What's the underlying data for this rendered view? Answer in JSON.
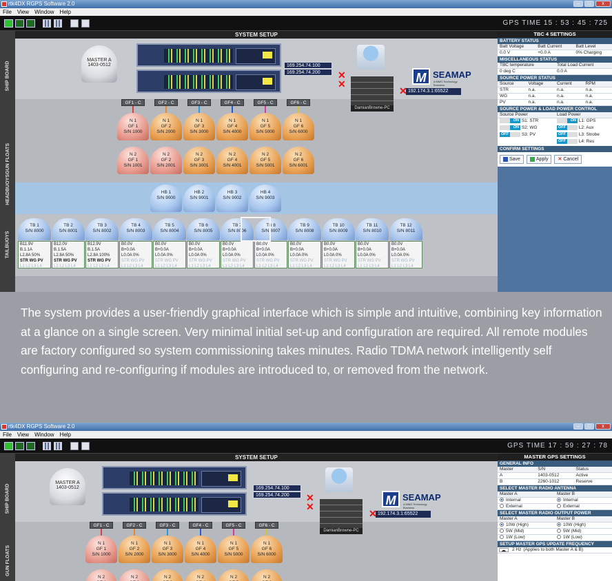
{
  "window": {
    "title": "rtk4DX RGPS Software 2.0",
    "menu": [
      "File",
      "View",
      "Window",
      "Help"
    ]
  },
  "screen1": {
    "gps_time": "GPS TIME  15 : 53 : 45 : 725",
    "system_setup": "SYSTEM SETUP",
    "sidebar": [
      "SHIP BOARD",
      "GUN FLOATS",
      "HEADBUOYS",
      "TAILBUOYS"
    ],
    "master": {
      "name": "MASTER A",
      "serial": "1403-0512"
    },
    "rack_rows": [
      "warn · pwr · lock · sv",
      "tx · rx · rxf · err"
    ],
    "rack_eth": [
      "ethnet link 100b tx rx",
      "ethnet link 100b tx rx"
    ],
    "ips": [
      "169.254.74.100",
      "169.254.74.200"
    ],
    "pc_name": "DamianBrowne-PC",
    "seamap": {
      "name": "SEAMAP",
      "tag": "A MMG Technology Business"
    },
    "remote_ip": "192.174.3.1:65522",
    "gf_labels": [
      "GF1 - C",
      "GF2 - C",
      "GF3 - C",
      "GF4 - C",
      "GF5 - C",
      "GF6 - C"
    ],
    "floats_n1": [
      [
        "N 1",
        "GF 1",
        "S/N 1000"
      ],
      [
        "N 1",
        "GF 2",
        "S/N 2000"
      ],
      [
        "N 1",
        "GF 3",
        "S/N 3000"
      ],
      [
        "N 1",
        "GF 4",
        "S/N 4000"
      ],
      [
        "N 1",
        "GF 5",
        "S/N 5000"
      ],
      [
        "N 1",
        "GF 6",
        "S/N 6000"
      ]
    ],
    "floats_n2": [
      [
        "N 2",
        "GF 1",
        "S/N 1001"
      ],
      [
        "N 2",
        "GF 2",
        "S/N 2001"
      ],
      [
        "N 2",
        "GF 3",
        "S/N 3001"
      ],
      [
        "N 2",
        "GF 4",
        "S/N 4001"
      ],
      [
        "N 2",
        "GF 5",
        "S/N 5001"
      ],
      [
        "N 2",
        "GF 6",
        "S/N 6001"
      ]
    ],
    "headbuoys": [
      [
        "HB 1",
        "S/N 9000"
      ],
      [
        "HB 2",
        "S/N 9001"
      ],
      [
        "HB 3",
        "S/N 9002"
      ],
      [
        "HB 4",
        "S/N 9003"
      ]
    ],
    "tailbuoys": [
      {
        "name": "TB 1",
        "sn": "S/N 8000",
        "l1": "B11.9V",
        "l2": "B.1.1A",
        "l3": "L2.8A 50%"
      },
      {
        "name": "TB 2",
        "sn": "S/N 8001",
        "l1": "B12.0V",
        "l2": "B.1.5A",
        "l3": "L2.8A 50%"
      },
      {
        "name": "TB 3",
        "sn": "S/N 8002",
        "l1": "B12.9V",
        "l2": "B.1.5A",
        "l3": "L2.8A 100%"
      },
      {
        "name": "TB 4",
        "sn": "S/N 8003",
        "l1": "B0.0V",
        "l2": "B+0.0A",
        "l3": "L0.0A 0%"
      },
      {
        "name": "TB 5",
        "sn": "S/N 8004",
        "l1": "B0.0V",
        "l2": "B+0.0A",
        "l3": "L0.0A 0%"
      },
      {
        "name": "TB 6",
        "sn": "S/N 8005",
        "l1": "B0.0V",
        "l2": "B+0.0A",
        "l3": "L0.0A 0%"
      },
      {
        "name": "TB 7",
        "sn": "S/N 8006",
        "l1": "B0.0V",
        "l2": "B+0.0A",
        "l3": "L0.0A 0%"
      },
      {
        "name": "TB 8",
        "sn": "S/N 8007",
        "l1": "B0.0V",
        "l2": "B+0.0A",
        "l3": "L0.0A 0%"
      },
      {
        "name": "TB 9",
        "sn": "S/N 8008",
        "l1": "B0.0V",
        "l2": "B+0.0A",
        "l3": "L0.0A 0%"
      },
      {
        "name": "TB 10",
        "sn": "S/N 8009",
        "l1": "B0.0V",
        "l2": "B+0.0A",
        "l3": "L0.0A 0%"
      },
      {
        "name": "TB 11",
        "sn": "S/N 8010",
        "l1": "B0.0V",
        "l2": "B+0.0A",
        "l3": "L0.0A 0%"
      },
      {
        "name": "TB 12",
        "sn": "S/N 8011",
        "l1": "B0.0V",
        "l2": "B+0.0A",
        "l3": "L0.0A 0%"
      }
    ],
    "tail_status": "STR WG PV",
    "tail_loads": "L1 L2 L3 L4",
    "panel": {
      "title": "TBC 4 SETTINGS",
      "battery": {
        "head": "BATTERY STATUS",
        "cols": [
          "Batt Voltage",
          "Batt Current",
          "Batt Level"
        ],
        "vals": [
          "0.0 V",
          "+0.0 A",
          "0% Charging"
        ]
      },
      "misc": {
        "head": "MISCELLANEOUS STATUS",
        "cols": [
          "TBC temperature",
          "Total Load Current"
        ],
        "vals": [
          "0 deg C",
          "0.0 A"
        ]
      },
      "source": {
        "head": "SOURCE POWER STATUS",
        "cols": [
          "Source",
          "Voltage",
          "Current",
          "RPM"
        ],
        "rows": [
          [
            "STR",
            "n.a.",
            "n.a.",
            "n.a."
          ],
          [
            "WG",
            "n.a.",
            "n.a.",
            "n.a."
          ],
          [
            "PV",
            "n.a.",
            "n.a.",
            "n.a."
          ]
        ]
      },
      "control": {
        "head": "SOURCE POWER & LOAD POWER CONTROL",
        "col1": "Source Power",
        "col2": "Load Power",
        "src": [
          [
            "ON",
            "S1: STR"
          ],
          [
            "ON",
            "S2: WG"
          ],
          [
            "OFF",
            "S3: PV"
          ]
        ],
        "load": [
          [
            "ON",
            "L1: GPS"
          ],
          [
            "OFF",
            "L2: Aux"
          ],
          [
            "OFF",
            "L3: Strobe"
          ],
          [
            "OFF",
            "L4: Res"
          ]
        ]
      },
      "confirm": {
        "head": "CONFIRM SETTINGS",
        "save": "Save",
        "apply": "Apply",
        "cancel": "Cancel"
      }
    }
  },
  "overlay_text": "The system provides a user-friendly graphical interface which is simple and intuitive, combining key information at a glance on a single screen. Very minimal initial set-up and configuration are required. All remote modules are factory configured so system commissioning takes minutes. Radio TDMA network intelligently self configuring and re-configuring if modules are introduced to, or removed from the network.",
  "screen2": {
    "gps_time": "GPS TIME  17 : 59 : 27 : 78",
    "panel": {
      "title": "MASTER GPS SETTINGS",
      "general": {
        "head": "GENERAL INFO",
        "cols": [
          "Master",
          "S/N",
          "Status"
        ],
        "rows": [
          [
            "A",
            "1403-0512",
            "Active"
          ],
          [
            "B",
            "2260-1012",
            "Reserve"
          ]
        ]
      },
      "antenna": {
        "head": "SELECT MASTER RADIO ANTENNA",
        "cols": [
          "Master A",
          "Master B"
        ],
        "opts": [
          "Internal",
          "External"
        ]
      },
      "power": {
        "head": "SELECT MASTER RADIO OUTPUT POWER",
        "cols": [
          "Master A",
          "Master B"
        ],
        "opts": [
          "10W (High)",
          "5W (Mid)",
          "1W (Low)"
        ]
      },
      "freq": {
        "head": "SETUP MASTER GPS UPDATE FREQUENCY",
        "val": "2 Hz",
        "note": "(Applies to both Master A & B)"
      }
    }
  }
}
